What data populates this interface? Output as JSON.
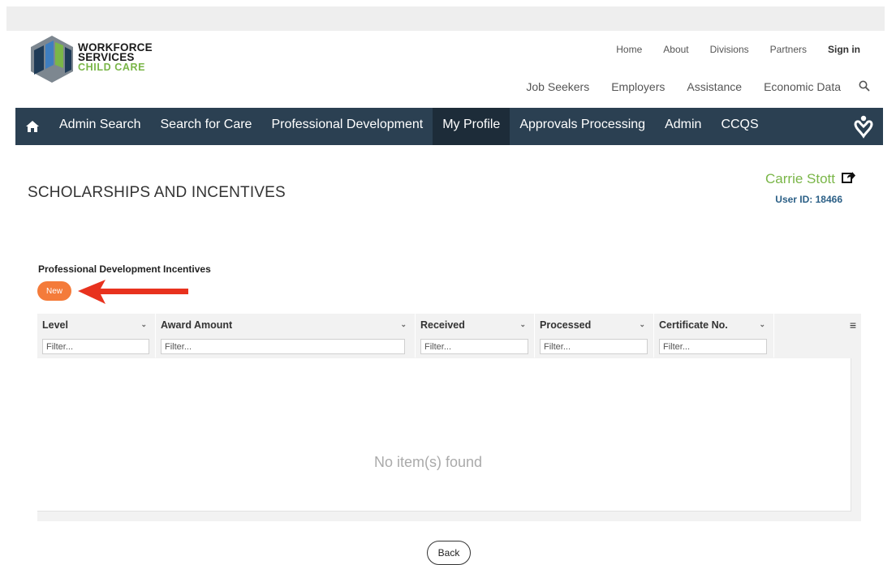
{
  "brand": {
    "line1": "WORKFORCE",
    "line2": "SERVICES",
    "line3": "CHILD CARE"
  },
  "util_nav": [
    "Home",
    "About",
    "Divisions",
    "Partners",
    "Sign in"
  ],
  "sec_nav": [
    "Job Seekers",
    "Employers",
    "Assistance",
    "Economic Data"
  ],
  "main_nav": [
    "Admin Search",
    "Search for Care",
    "Professional Development",
    "My Profile",
    "Approvals Processing",
    "Admin",
    "CCQS"
  ],
  "main_nav_active": "My Profile",
  "page": {
    "title": "SCHOLARSHIPS AND INCENTIVES"
  },
  "user": {
    "name": "Carrie Stott",
    "id_label": "User ID: 18466"
  },
  "section": {
    "title": "Professional Development Incentives",
    "new_label": "New"
  },
  "grid": {
    "columns": [
      "Level",
      "Award Amount",
      "Received",
      "Processed",
      "Certificate No."
    ],
    "filter_placeholder": "Filter...",
    "empty_text": "No item(s) found"
  },
  "back_label": "Back",
  "colors": {
    "nav_bg": "#2b4052",
    "accent_green": "#7ab648",
    "new_button": "#f47b3a",
    "arrow": "#e8321e",
    "user_id": "#2b5f86"
  }
}
